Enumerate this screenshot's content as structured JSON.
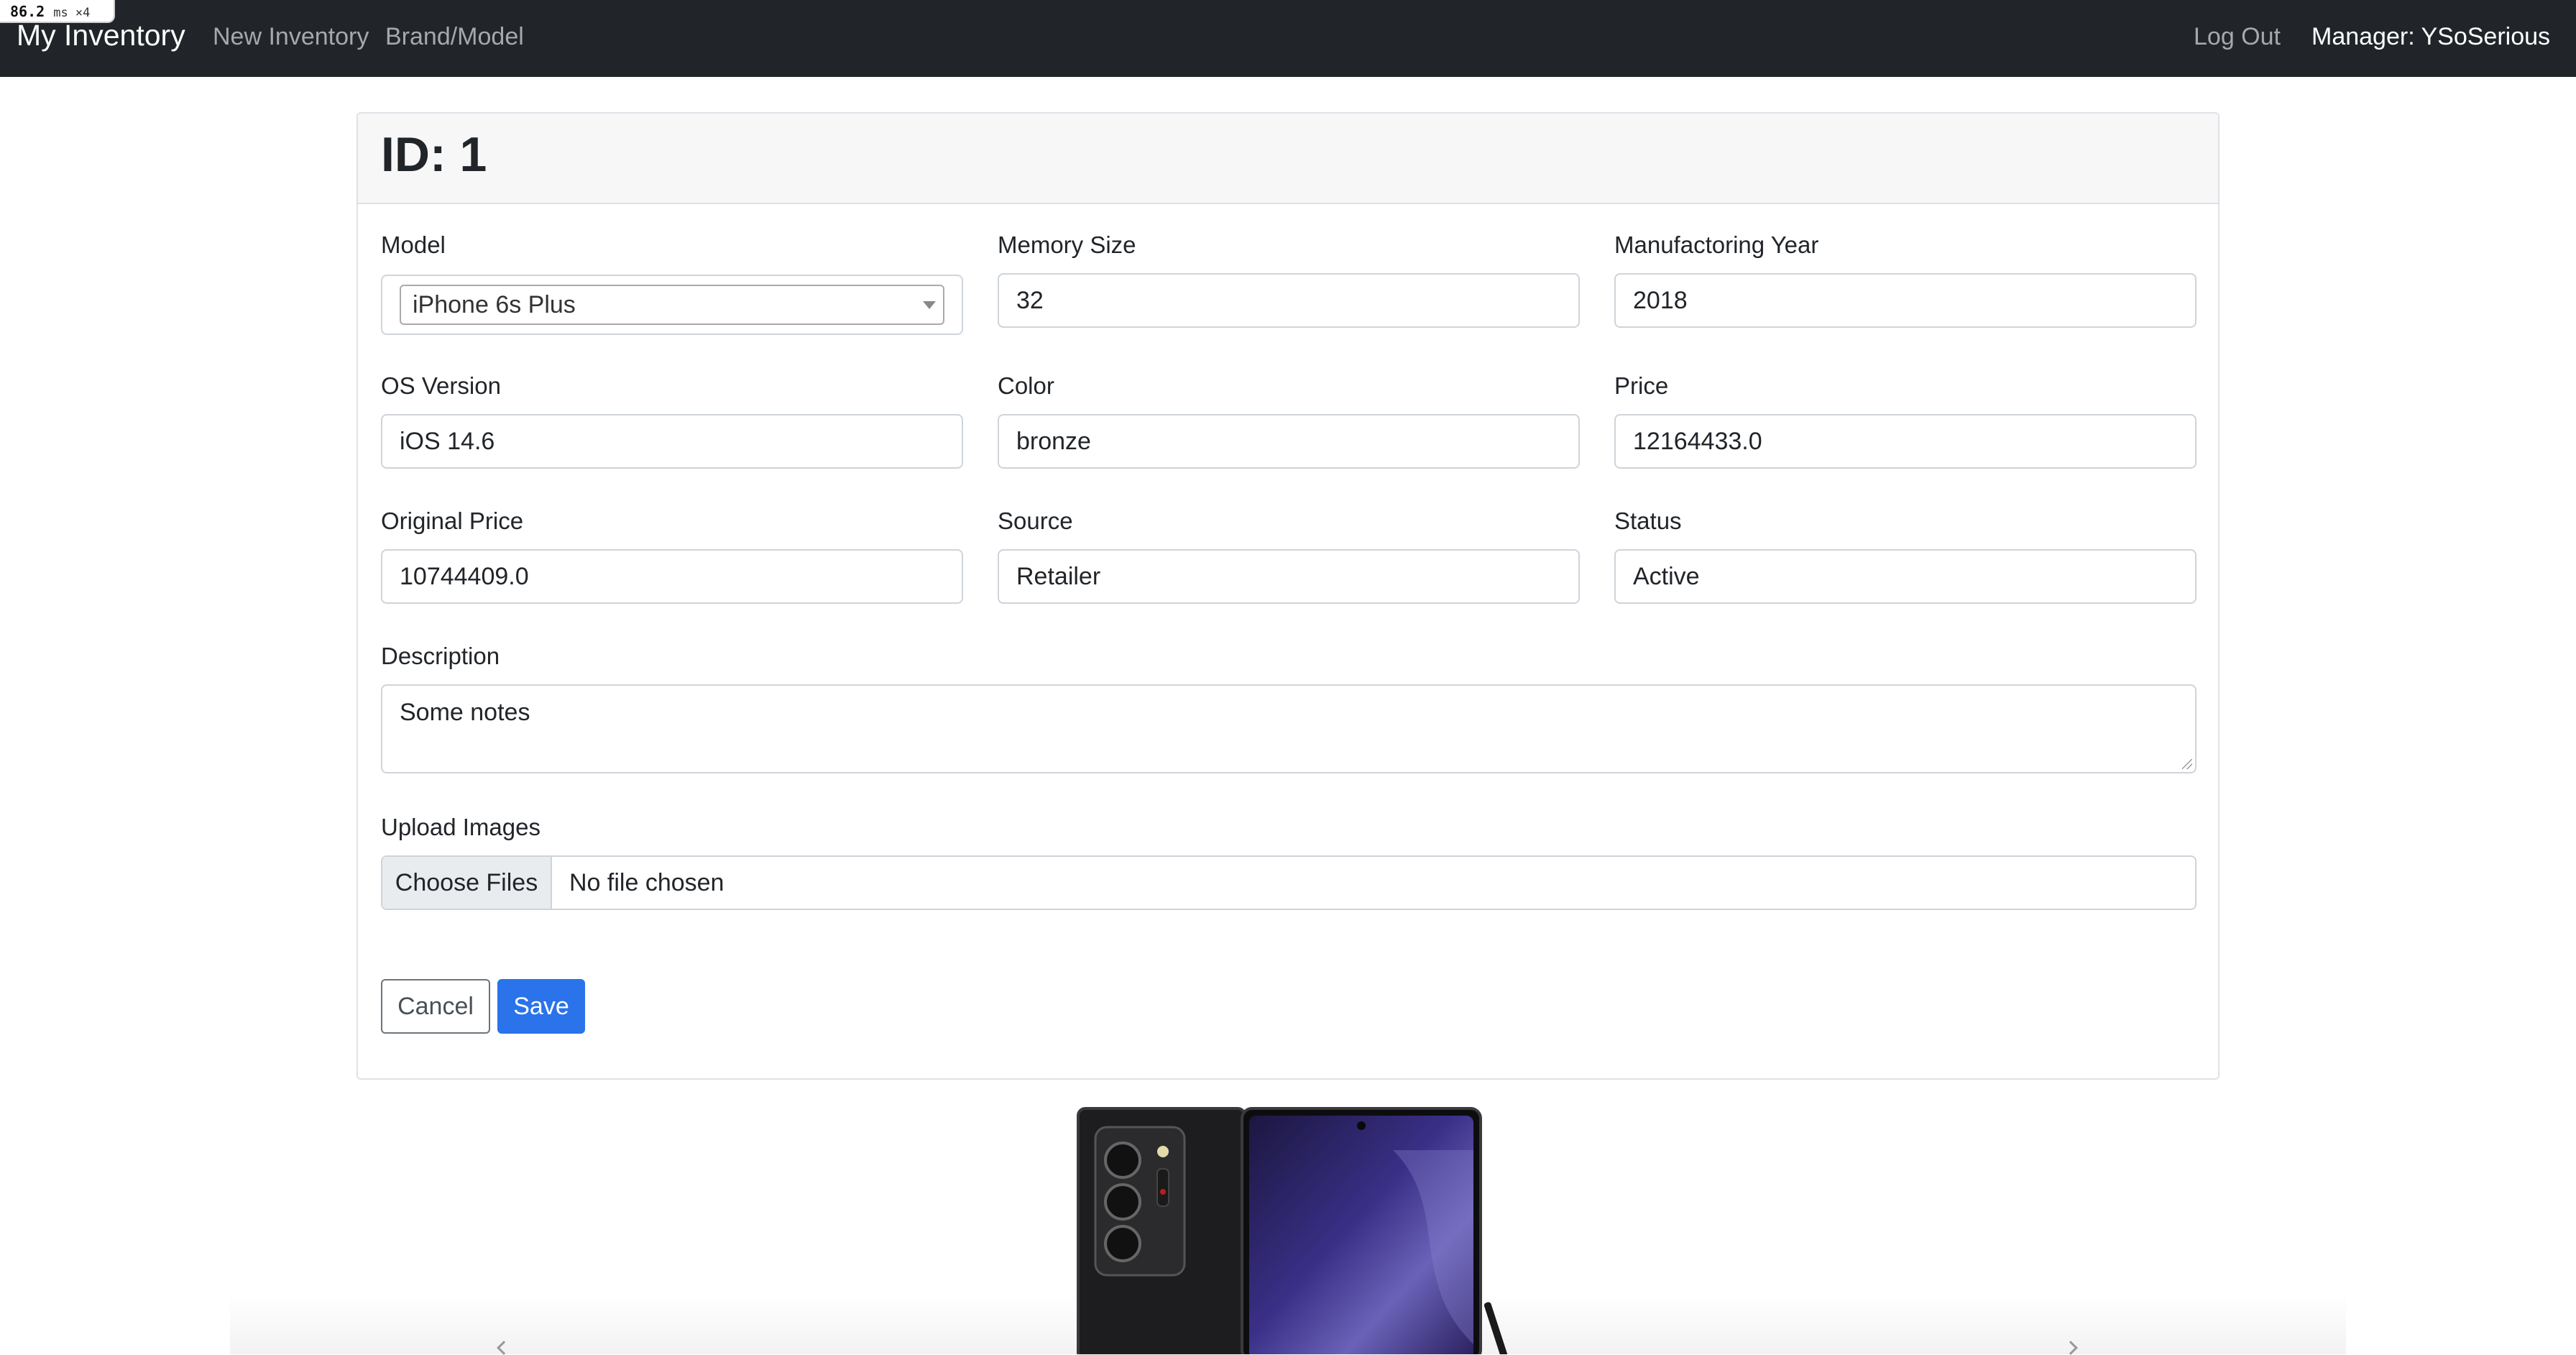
{
  "perf_badge": {
    "value": "86.2",
    "unit": "ms ×4"
  },
  "navbar": {
    "brand": "My Inventory",
    "links": {
      "new_inventory": "New Inventory",
      "brand_model": "Brand/Model",
      "log_out": "Log Out",
      "manager": "Manager: YSoSerious"
    }
  },
  "card": {
    "title": "ID: 1",
    "fields": {
      "model": {
        "label": "Model",
        "value": "iPhone 6s Plus"
      },
      "memory_size": {
        "label": "Memory Size",
        "value": "32"
      },
      "manufacturing_year": {
        "label": "Manufactoring Year",
        "value": "2018"
      },
      "os_version": {
        "label": "OS Version",
        "value": "iOS 14.6"
      },
      "color": {
        "label": "Color",
        "value": "bronze"
      },
      "price": {
        "label": "Price",
        "value": "12164433.0"
      },
      "original_price": {
        "label": "Original Price",
        "value": "10744409.0"
      },
      "source": {
        "label": "Source",
        "value": "Retailer"
      },
      "status": {
        "label": "Status",
        "value": "Active"
      },
      "description": {
        "label": "Description",
        "value": "Some notes"
      },
      "upload_images": {
        "label": "Upload Images",
        "button": "Choose Files",
        "status": "No file chosen"
      }
    },
    "buttons": {
      "cancel": "Cancel",
      "save": "Save"
    }
  },
  "colors": {
    "navbar_bg": "#212529",
    "primary": "#2a73ea",
    "card_header_bg": "#f7f7f7"
  },
  "icons": {
    "select_arrow": "chevron-down-icon",
    "carousel_prev": "chevron-left-icon",
    "carousel_next": "chevron-right-icon"
  }
}
